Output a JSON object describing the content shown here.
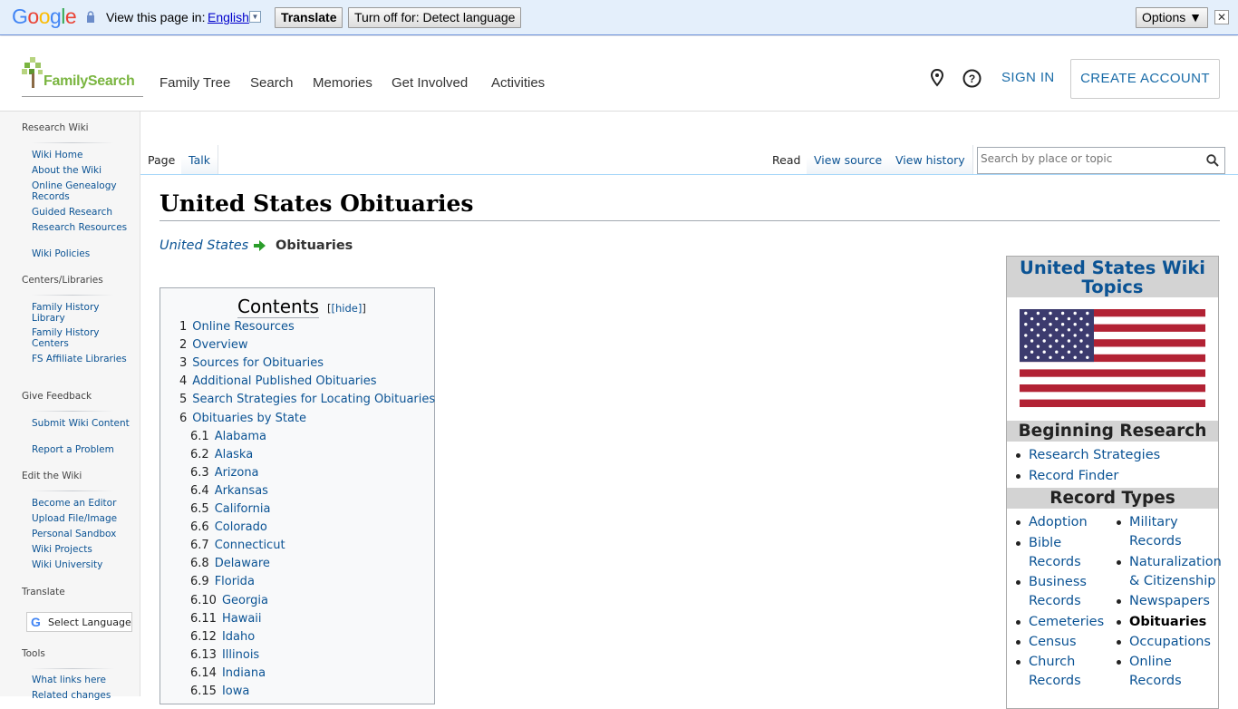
{
  "translate_bar": {
    "logo": "Google",
    "view_text": "View this page in:",
    "language": "English",
    "translate_button": "Translate",
    "turnoff_button": "Turn off for: Detect language",
    "options_button": "Options ▼",
    "close": "✕"
  },
  "header": {
    "logo": "FamilySearch",
    "nav": [
      "Family Tree",
      "Search",
      "Memories",
      "Get Involved",
      "Activities"
    ],
    "sign_in": "SIGN IN",
    "create_account": "CREATE ACCOUNT"
  },
  "sidebar": {
    "sections": [
      {
        "heading": "Research Wiki",
        "items": [
          "Wiki Home",
          "About the Wiki",
          "Online Genealogy Records",
          "Guided Research",
          "Research Resources",
          "Wiki Policies"
        ]
      },
      {
        "heading": "Centers/Libraries",
        "items": [
          "Family History Library",
          "Family History Centers",
          "FS Affiliate Libraries"
        ]
      },
      {
        "heading": "Give Feedback",
        "items": [
          "Submit Wiki Content",
          "Report a Problem"
        ]
      },
      {
        "heading": "Edit the Wiki",
        "items": [
          "Become an Editor",
          "Upload File/Image",
          "Personal Sandbox",
          "Wiki Projects",
          "Wiki University"
        ]
      },
      {
        "heading": "Translate",
        "items": []
      },
      {
        "heading": "Tools",
        "items": [
          "What links here",
          "Related changes"
        ]
      }
    ],
    "select_language": "Select Language"
  },
  "tabs": {
    "left": [
      "Page",
      "Talk"
    ],
    "right": [
      "Read",
      "View source",
      "View history"
    ],
    "search_placeholder": "Search by place or topic"
  },
  "page": {
    "title": "United States Obituaries",
    "breadcrumb_parent": "United States",
    "breadcrumb_current": "Obituaries"
  },
  "toc": {
    "title": "Contents",
    "hide": "[hide]",
    "items": [
      {
        "num": "1",
        "label": "Online Resources",
        "level": 1
      },
      {
        "num": "2",
        "label": "Overview",
        "level": 1
      },
      {
        "num": "3",
        "label": "Sources for Obituaries",
        "level": 1
      },
      {
        "num": "4",
        "label": "Additional Published Obituaries",
        "level": 1
      },
      {
        "num": "5",
        "label": "Search Strategies for Locating Obituaries",
        "level": 1
      },
      {
        "num": "6",
        "label": "Obituaries by State",
        "level": 1
      },
      {
        "num": "6.1",
        "label": "Alabama",
        "level": 2
      },
      {
        "num": "6.2",
        "label": "Alaska",
        "level": 2
      },
      {
        "num": "6.3",
        "label": "Arizona",
        "level": 2
      },
      {
        "num": "6.4",
        "label": "Arkansas",
        "level": 2
      },
      {
        "num": "6.5",
        "label": "California",
        "level": 2
      },
      {
        "num": "6.6",
        "label": "Colorado",
        "level": 2
      },
      {
        "num": "6.7",
        "label": "Connecticut",
        "level": 2
      },
      {
        "num": "6.8",
        "label": "Delaware",
        "level": 2
      },
      {
        "num": "6.9",
        "label": "Florida",
        "level": 2
      },
      {
        "num": "6.10",
        "label": "Georgia",
        "level": 2
      },
      {
        "num": "6.11",
        "label": "Hawaii",
        "level": 2
      },
      {
        "num": "6.12",
        "label": "Idaho",
        "level": 2
      },
      {
        "num": "6.13",
        "label": "Illinois",
        "level": 2
      },
      {
        "num": "6.14",
        "label": "Indiana",
        "level": 2
      },
      {
        "num": "6.15",
        "label": "Iowa",
        "level": 2
      }
    ]
  },
  "infobox": {
    "title": "United States Wiki Topics",
    "beginning_heading": "Beginning Research",
    "beginning_items": [
      "Research Strategies",
      "Record Finder"
    ],
    "record_types_heading": "Record Types",
    "record_types_col1": [
      "Adoption",
      "Bible Records",
      "Business Records",
      "Cemeteries",
      "Census",
      "Church Records"
    ],
    "record_types_col2": [
      "Military Records",
      "Naturalization & Citizenship",
      "Newspapers",
      "Obituaries",
      "Occupations",
      "Online Records"
    ],
    "current": "Obituaries"
  },
  "colors": {
    "link": "#0b5394",
    "brand_green": "#7ab540",
    "translate_bar": "#e4effb"
  }
}
